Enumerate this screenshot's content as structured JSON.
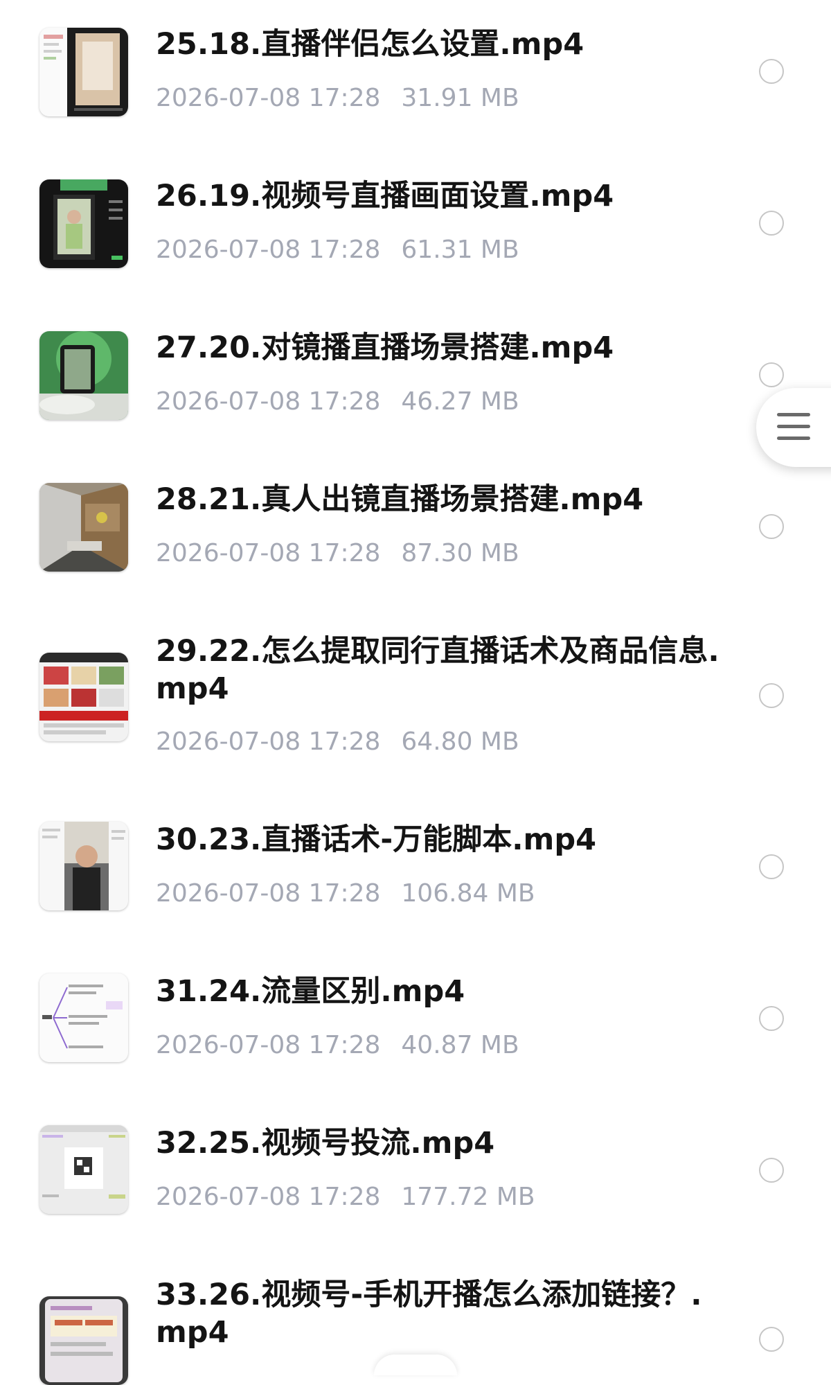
{
  "files": [
    {
      "name": "25.18.直播伴侣怎么设置.mp4",
      "date": "2026-07-08 17:28",
      "size": "31.91 MB",
      "thumb_icon": "video-thumbnail"
    },
    {
      "name": "26.19.视频号直播画面设置.mp4",
      "date": "2026-07-08 17:28",
      "size": "61.31 MB",
      "thumb_icon": "video-thumbnail"
    },
    {
      "name": "27.20.对镜播直播场景搭建.mp4",
      "date": "2026-07-08 17:28",
      "size": "46.27 MB",
      "thumb_icon": "video-thumbnail"
    },
    {
      "name": "28.21.真人出镜直播场景搭建.mp4",
      "date": "2026-07-08 17:28",
      "size": "87.30 MB",
      "thumb_icon": "video-thumbnail"
    },
    {
      "name": "29.22.怎么提取同行直播话术及商品信息.mp4",
      "date": "2026-07-08 17:28",
      "size": "64.80 MB",
      "thumb_icon": "video-thumbnail"
    },
    {
      "name": "30.23.直播话术-万能脚本.mp4",
      "date": "2026-07-08 17:28",
      "size": "106.84 MB",
      "thumb_icon": "video-thumbnail"
    },
    {
      "name": "31.24.流量区别.mp4",
      "date": "2026-07-08 17:28",
      "size": "40.87 MB",
      "thumb_icon": "video-thumbnail"
    },
    {
      "name": "32.25.视频号投流.mp4",
      "date": "2026-07-08 17:28",
      "size": "177.72 MB",
      "thumb_icon": "video-thumbnail"
    },
    {
      "name": "33.26.视频号-手机开播怎么添加链接？.mp4",
      "date": "",
      "size": "",
      "thumb_icon": "video-thumbnail"
    }
  ],
  "float_menu": {
    "icon": "menu-icon"
  },
  "colors": {
    "title": "#141414",
    "meta": "#a4a8b4",
    "radio_border": "#c6c6c6",
    "background": "#ffffff"
  }
}
